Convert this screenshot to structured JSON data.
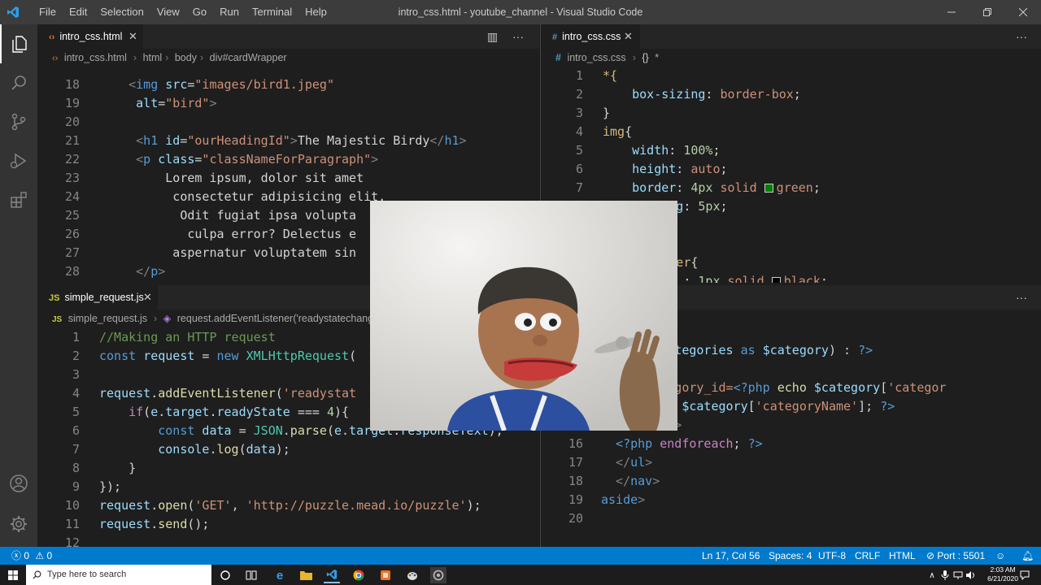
{
  "window": {
    "title": "intro_css.html - youtube_channel - Visual Studio Code",
    "menu": [
      "File",
      "Edit",
      "Selection",
      "View",
      "Go",
      "Run",
      "Terminal",
      "Help"
    ]
  },
  "activity_icons": [
    "files-icon",
    "search-icon",
    "source-control-icon",
    "run-debug-icon",
    "extensions-icon",
    "account-icon",
    "settings-gear-icon"
  ],
  "pane_html": {
    "tab": {
      "label": "intro_css.html"
    },
    "breadcrumbs": [
      "intro_css.html",
      "html",
      "body",
      "div#cardWrapper"
    ],
    "lines": [
      {
        "n": "18",
        "segs": [
          [
            "brk",
            "<"
          ],
          [
            "tag",
            "img"
          ],
          [
            "txt",
            " "
          ],
          [
            "attr",
            "src"
          ],
          [
            "txt",
            "="
          ],
          [
            "str",
            "\"images/bird1.jpeg\""
          ]
        ],
        "indent": 4
      },
      {
        "n": "19",
        "segs": [
          [
            "attr",
            "alt"
          ],
          [
            "txt",
            "="
          ],
          [
            "str",
            "\"bird\""
          ],
          [
            "brk",
            ">"
          ]
        ],
        "indent": 5
      },
      {
        "n": "20",
        "segs": [],
        "indent": 0
      },
      {
        "n": "21",
        "segs": [
          [
            "brk",
            "<"
          ],
          [
            "tag",
            "h1"
          ],
          [
            "txt",
            " "
          ],
          [
            "attr",
            "id"
          ],
          [
            "txt",
            "="
          ],
          [
            "str",
            "\"ourHeadingId\""
          ],
          [
            "brk",
            ">"
          ],
          [
            "txt",
            "The Majestic Birdy"
          ],
          [
            "brk",
            "</"
          ],
          [
            "tag",
            "h1"
          ],
          [
            "brk",
            ">"
          ]
        ],
        "indent": 5
      },
      {
        "n": "22",
        "segs": [
          [
            "brk",
            "<"
          ],
          [
            "tag",
            "p"
          ],
          [
            "txt",
            " "
          ],
          [
            "attr",
            "class"
          ],
          [
            "txt",
            "="
          ],
          [
            "str",
            "\"classNameForParagraph\""
          ],
          [
            "brk",
            ">"
          ]
        ],
        "indent": 5
      },
      {
        "n": "23",
        "segs": [
          [
            "txt",
            "Lorem ipsum, dolor sit amet"
          ]
        ],
        "indent": 9
      },
      {
        "n": "24",
        "segs": [
          [
            "txt",
            "consectetur adipisicing elit."
          ]
        ],
        "indent": 10
      },
      {
        "n": "25",
        "segs": [
          [
            "txt",
            "Odit fugiat ipsa volupta"
          ]
        ],
        "indent": 11
      },
      {
        "n": "26",
        "segs": [
          [
            "txt",
            "culpa error? Delectus e"
          ]
        ],
        "indent": 12
      },
      {
        "n": "27",
        "segs": [
          [
            "txt",
            "aspernatur voluptatem sin"
          ]
        ],
        "indent": 10
      },
      {
        "n": "28",
        "segs": [
          [
            "brk",
            "</"
          ],
          [
            "tag",
            "p"
          ],
          [
            "brk",
            ">"
          ]
        ],
        "indent": 5
      }
    ]
  },
  "pane_css": {
    "tab": {
      "label": "intro_css.css"
    },
    "breadcrumbs": [
      "intro_css.css",
      "*"
    ],
    "lines": [
      {
        "n": "1",
        "segs": [
          [
            "sel",
            "*{"
          ]
        ],
        "indent": 0
      },
      {
        "n": "2",
        "segs": [
          [
            "prop",
            "box-sizing"
          ],
          [
            "txt",
            ": "
          ],
          [
            "str",
            "border-box"
          ],
          [
            "txt",
            ";"
          ]
        ],
        "indent": 4
      },
      {
        "n": "3",
        "segs": [
          [
            "txt",
            "}"
          ]
        ],
        "indent": 0
      },
      {
        "n": "4",
        "segs": [
          [
            "sel",
            "img"
          ],
          [
            "txt",
            "{"
          ]
        ],
        "indent": 0
      },
      {
        "n": "5",
        "segs": [
          [
            "prop",
            "width"
          ],
          [
            "txt",
            ": "
          ],
          [
            "num",
            "100%"
          ],
          [
            "txt",
            ";"
          ]
        ],
        "indent": 4
      },
      {
        "n": "6",
        "segs": [
          [
            "prop",
            "height"
          ],
          [
            "txt",
            ": "
          ],
          [
            "str",
            "auto"
          ],
          [
            "txt",
            ";"
          ]
        ],
        "indent": 4
      },
      {
        "n": "7",
        "segs": [
          [
            "prop",
            "border"
          ],
          [
            "txt",
            ": "
          ],
          [
            "num",
            "4px"
          ],
          [
            "txt",
            " "
          ],
          [
            "str",
            "solid "
          ],
          [
            "swatch-green",
            ""
          ],
          [
            "str",
            "green"
          ],
          [
            "txt",
            ";"
          ]
        ],
        "indent": 4
      },
      {
        "n": "",
        "segs": [
          [
            "prop",
            "g"
          ],
          [
            "txt",
            ": "
          ],
          [
            "num",
            "5px"
          ],
          [
            "txt",
            ";"
          ]
        ],
        "indent": 10
      },
      {
        "n": "",
        "segs": [],
        "indent": 0
      },
      {
        "n": "",
        "segs": [],
        "indent": 0
      },
      {
        "n": "",
        "segs": [
          [
            "sel",
            "er"
          ],
          [
            "txt",
            "{"
          ]
        ],
        "indent": 10
      },
      {
        "n": "",
        "segs": [
          [
            "txt",
            ": "
          ],
          [
            "num",
            "1px"
          ],
          [
            "txt",
            " "
          ],
          [
            "str",
            "solid "
          ],
          [
            "swatch-black",
            ""
          ],
          [
            "str",
            "black"
          ],
          [
            "txt",
            ";"
          ]
        ],
        "indent": 11
      }
    ]
  },
  "pane_js": {
    "tab": {
      "label": "simple_request.js",
      "icon": "JS"
    },
    "breadcrumbs": [
      "simple_request.js",
      "request.addEventListener('readystatechange"
    ],
    "lines": [
      {
        "n": "1",
        "segs": [
          [
            "cm",
            "//Making an HTTP request"
          ]
        ],
        "indent": 0
      },
      {
        "n": "2",
        "segs": [
          [
            "kw",
            "const"
          ],
          [
            "txt",
            " "
          ],
          [
            "var",
            "request"
          ],
          [
            "txt",
            " = "
          ],
          [
            "kw",
            "new"
          ],
          [
            "txt",
            " "
          ],
          [
            "cls",
            "XMLHttpRequest"
          ],
          [
            "txt",
            "("
          ]
        ],
        "indent": 0
      },
      {
        "n": "3",
        "segs": [],
        "indent": 0
      },
      {
        "n": "4",
        "segs": [
          [
            "var",
            "request"
          ],
          [
            "txt",
            "."
          ],
          [
            "fn",
            "addEventListener"
          ],
          [
            "txt",
            "("
          ],
          [
            "str",
            "'readystat"
          ]
        ],
        "indent": 0
      },
      {
        "n": "5",
        "segs": [
          [
            "ctrl",
            "if"
          ],
          [
            "txt",
            "("
          ],
          [
            "var",
            "e"
          ],
          [
            "txt",
            "."
          ],
          [
            "var",
            "target"
          ],
          [
            "txt",
            "."
          ],
          [
            "var",
            "readyState"
          ],
          [
            "txt",
            " === "
          ],
          [
            "num",
            "4"
          ],
          [
            "txt",
            "){"
          ]
        ],
        "indent": 4
      },
      {
        "n": "6",
        "segs": [
          [
            "kw",
            "const"
          ],
          [
            "txt",
            " "
          ],
          [
            "var",
            "data"
          ],
          [
            "txt",
            " = "
          ],
          [
            "cls",
            "JSON"
          ],
          [
            "txt",
            "."
          ],
          [
            "fn",
            "parse"
          ],
          [
            "txt",
            "("
          ],
          [
            "var",
            "e"
          ],
          [
            "txt",
            "."
          ],
          [
            "var",
            "target"
          ],
          [
            "txt",
            "."
          ],
          [
            "var",
            "responseText"
          ],
          [
            "txt",
            ");"
          ]
        ],
        "indent": 8
      },
      {
        "n": "7",
        "segs": [
          [
            "var",
            "console"
          ],
          [
            "txt",
            "."
          ],
          [
            "fn",
            "log"
          ],
          [
            "txt",
            "("
          ],
          [
            "var",
            "data"
          ],
          [
            "txt",
            ");"
          ]
        ],
        "indent": 8
      },
      {
        "n": "8",
        "segs": [
          [
            "txt",
            "}"
          ]
        ],
        "indent": 4
      },
      {
        "n": "9",
        "segs": [
          [
            "txt",
            "});"
          ]
        ],
        "indent": 0
      },
      {
        "n": "10",
        "segs": [
          [
            "var",
            "request"
          ],
          [
            "txt",
            "."
          ],
          [
            "fn",
            "open"
          ],
          [
            "txt",
            "("
          ],
          [
            "str",
            "'GET'"
          ],
          [
            "txt",
            ", "
          ],
          [
            "str",
            "'http://puzzle.mead.io/puzzle'"
          ],
          [
            "txt",
            ");"
          ]
        ],
        "indent": 0
      },
      {
        "n": "11",
        "segs": [
          [
            "var",
            "request"
          ],
          [
            "txt",
            "."
          ],
          [
            "fn",
            "send"
          ],
          [
            "txt",
            "();"
          ]
        ],
        "indent": 0
      },
      {
        "n": "12",
        "segs": [],
        "indent": 0
      }
    ]
  },
  "pane_php": {
    "lines": [
      {
        "n": "",
        "segs": [
          [
            "ctrl",
            "reach"
          ],
          [
            "txt",
            " ("
          ],
          [
            "var",
            "$categories"
          ],
          [
            "txt",
            " "
          ],
          [
            "kw",
            "as"
          ],
          [
            "txt",
            " "
          ],
          [
            "var",
            "$category"
          ],
          [
            "txt",
            ") : "
          ],
          [
            "php",
            "?>"
          ]
        ],
        "indent": 0
      },
      {
        "n": "",
        "segs": [],
        "indent": 0
      },
      {
        "n": "",
        "segs": [
          [
            "attr",
            "ref"
          ],
          [
            "txt",
            "="
          ],
          [
            "str",
            "\"?category_id="
          ],
          [
            "php",
            "<?php"
          ],
          [
            "txt",
            " "
          ],
          [
            "fn",
            "echo"
          ],
          [
            "txt",
            " "
          ],
          [
            "var",
            "$category"
          ],
          [
            "txt",
            "["
          ],
          [
            "str",
            "'categor"
          ]
        ],
        "indent": 0
      },
      {
        "n": "",
        "segs": [
          [
            "php",
            "<?php"
          ],
          [
            "txt",
            " "
          ],
          [
            "fn",
            "echo"
          ],
          [
            "txt",
            " "
          ],
          [
            "var",
            "$category"
          ],
          [
            "txt",
            "["
          ],
          [
            "str",
            "'categoryName'"
          ],
          [
            "txt",
            "]; "
          ],
          [
            "php",
            "?>"
          ]
        ],
        "indent": 0
      },
      {
        "n": "15",
        "segs": [
          [
            "brk",
            "</"
          ],
          [
            "tag",
            "li"
          ],
          [
            "brk",
            ">"
          ]
        ],
        "indent": 6
      },
      {
        "n": "16",
        "segs": [
          [
            "php",
            "<?php"
          ],
          [
            "txt",
            " "
          ],
          [
            "ctrl",
            "endforeach"
          ],
          [
            "txt",
            "; "
          ],
          [
            "php",
            "?>"
          ]
        ],
        "indent": 2
      },
      {
        "n": "17",
        "segs": [
          [
            "brk",
            "</"
          ],
          [
            "tag",
            "ul"
          ],
          [
            "brk",
            ">"
          ]
        ],
        "indent": 2
      },
      {
        "n": "18",
        "segs": [
          [
            "brk",
            "</"
          ],
          [
            "tag",
            "nav"
          ],
          [
            "brk",
            ">"
          ]
        ],
        "indent": 2
      },
      {
        "n": "19",
        "segs": [
          [
            "tag",
            "aside"
          ],
          [
            "brk",
            ">"
          ]
        ],
        "indent": 0
      },
      {
        "n": "20",
        "segs": [],
        "indent": 0
      }
    ]
  },
  "statusbar": {
    "errors": "0",
    "warnings": "0",
    "position": "Ln 17, Col 56",
    "spaces": "Spaces: 4",
    "encoding": "UTF-8",
    "eol": "CRLF",
    "language": "HTML",
    "port": "Port : 5501"
  },
  "taskbar": {
    "search_placeholder": "Type here to search",
    "time": "2:03 AM",
    "date": "6/21/2020"
  },
  "colors": {
    "accent": "#007acc",
    "editor_bg": "#1e1e1e",
    "titlebar_bg": "#3c3c3c",
    "activitybar_bg": "#333333"
  }
}
